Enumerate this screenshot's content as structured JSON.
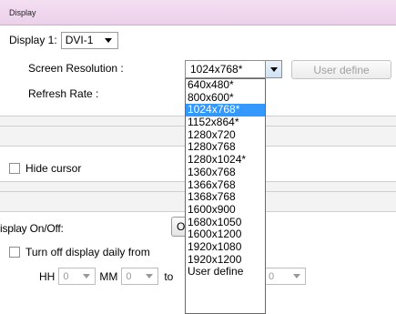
{
  "header": {
    "title": "Display"
  },
  "display_select": {
    "label": "Display 1:",
    "value": "DVI-1"
  },
  "resolution": {
    "label": "Screen Resolution :",
    "value": "1024x768*",
    "user_define_button": "User define",
    "options": [
      "640x480*",
      "800x600*",
      "1024x768*",
      "1152x864*",
      "1280x720",
      "1280x768",
      "1280x1024*",
      "1360x768",
      "1366x768",
      "1368x768",
      "1600x900",
      "1680x1050",
      "1600x1200",
      "1920x1080",
      "1920x1200",
      "User define"
    ],
    "selected_index": 2
  },
  "refresh": {
    "label": "Refresh Rate :"
  },
  "hide_cursor": {
    "label": "Hide cursor"
  },
  "onoff": {
    "label": "isplay On/Off:",
    "button_partial": "O"
  },
  "turn_off": {
    "label": "Turn off display daily from"
  },
  "time": {
    "hh_label": "HH",
    "hh_value": "0",
    "mm_label": "MM",
    "mm_value": "0",
    "to_label": "to",
    "end_value": "0"
  }
}
